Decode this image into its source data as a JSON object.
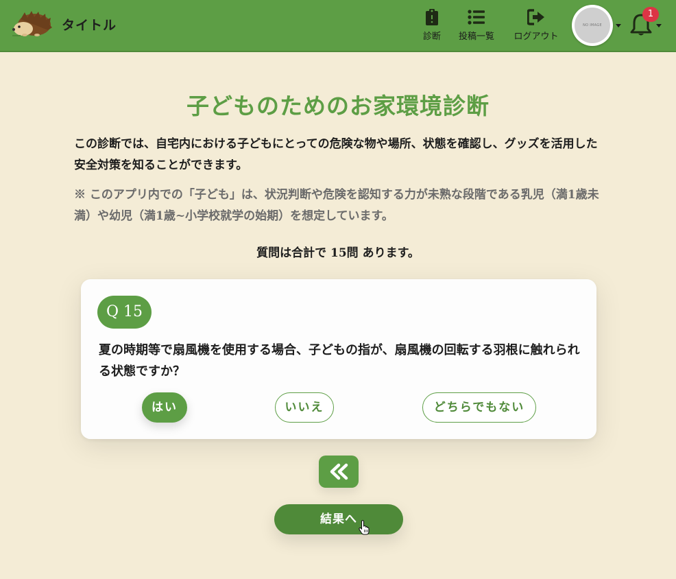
{
  "navbar": {
    "brand_title": "タイトル",
    "items": [
      {
        "label": "診断",
        "icon": "clipboard-icon"
      },
      {
        "label": "投稿一覧",
        "icon": "list-icon"
      },
      {
        "label": "ログアウト",
        "icon": "sign-out-icon"
      }
    ],
    "avatar_text": "NO IMAGE",
    "notification_count": "1"
  },
  "main": {
    "title": "子どものためのお家環境診断",
    "intro": "この診断では、自宅内における子どもにとっての危険な物や場所、状態を確認し、グッズを活用した安全対策を知ることができます。",
    "note": "※ このアプリ内での「子ども」は、状況判断や危険を認知する力が未熟な段階である乳児（満1歳未満）や幼児（満1歳~小学校就学の始期）を想定しています。",
    "question_count_text": "質問は合計で 15問 あります。"
  },
  "question": {
    "number_label": "Q 15",
    "text": "夏の時期等で扇風機を使用する場合、子どもの指が、扇風機の回転する羽根に触れられる状態ですか？",
    "answers": {
      "yes": "はい",
      "no": "いいえ",
      "neither": "どちらでもない"
    },
    "selected": "yes"
  },
  "actions": {
    "back_icon": "double-chevron-left-icon",
    "result_label": "結果へ"
  },
  "colors": {
    "primary": "#5d9e45",
    "primary_dark": "#4f8a39",
    "background": "#f4ecd6",
    "badge": "#dc3545"
  }
}
